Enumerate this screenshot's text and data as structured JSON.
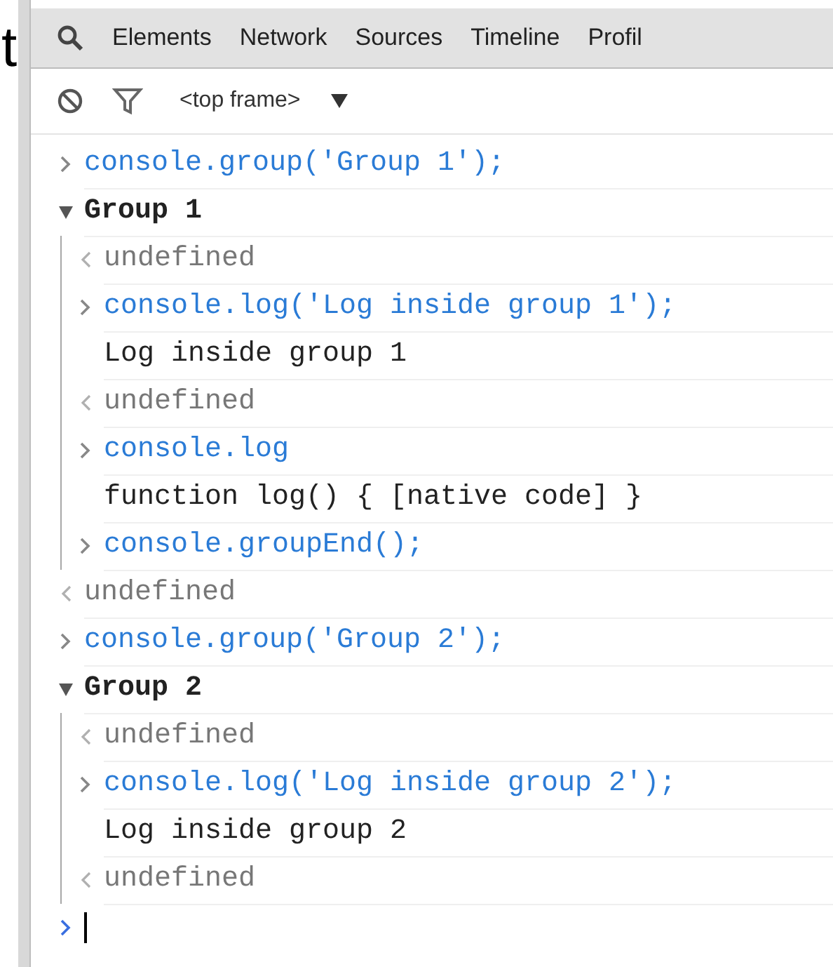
{
  "background_text": "t",
  "tabs": [
    {
      "label": "Elements"
    },
    {
      "label": "Network"
    },
    {
      "label": "Sources"
    },
    {
      "label": "Timeline"
    },
    {
      "label": "Profil"
    }
  ],
  "toolbar": {
    "frame_selector": "<top frame>"
  },
  "console": [
    {
      "kind": "input",
      "text": "console.group('Group 1');"
    },
    {
      "kind": "group",
      "text": "Group 1",
      "expanded": true,
      "children": [
        {
          "kind": "result",
          "text": "undefined"
        },
        {
          "kind": "input",
          "text": "console.log('Log inside group 1');"
        },
        {
          "kind": "log",
          "text": "Log inside group 1"
        },
        {
          "kind": "result",
          "text": "undefined"
        },
        {
          "kind": "input",
          "text": "console.log"
        },
        {
          "kind": "log",
          "text": "function log() { [native code] }"
        },
        {
          "kind": "input",
          "text": "console.groupEnd();"
        }
      ]
    },
    {
      "kind": "result",
      "text": "undefined"
    },
    {
      "kind": "input",
      "text": "console.group('Group 2');"
    },
    {
      "kind": "group",
      "text": "Group 2",
      "expanded": true,
      "children": [
        {
          "kind": "result",
          "text": "undefined"
        },
        {
          "kind": "input",
          "text": "console.log('Log inside group 2');"
        },
        {
          "kind": "log",
          "text": "Log inside group 2"
        },
        {
          "kind": "result",
          "text": "undefined"
        }
      ]
    }
  ]
}
